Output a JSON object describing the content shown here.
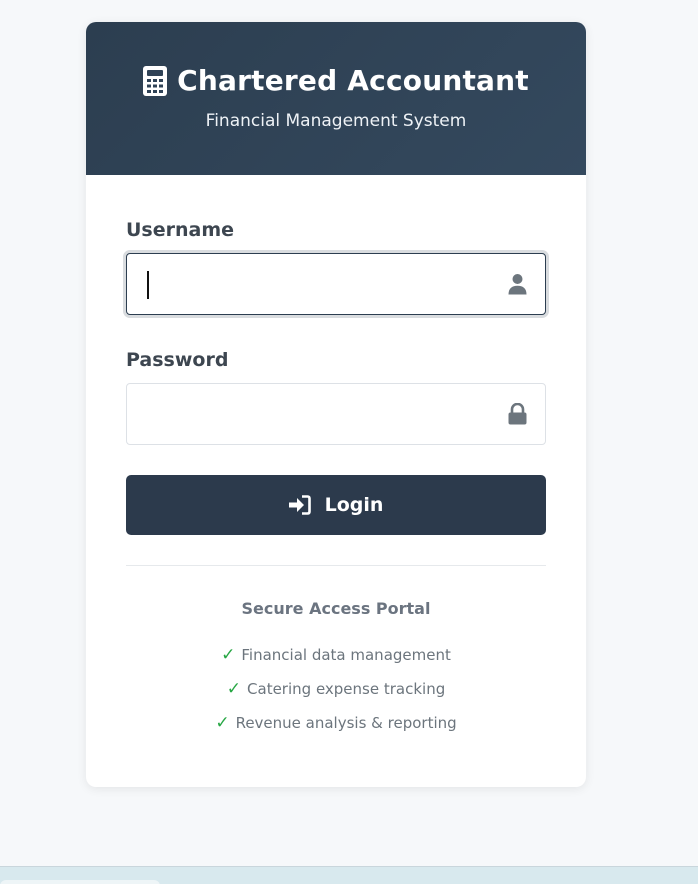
{
  "header": {
    "title": "Chartered Accountant",
    "subtitle": "Financial Management System",
    "icon": "calculator-icon"
  },
  "form": {
    "username": {
      "label": "Username",
      "value": "",
      "icon": "user-icon"
    },
    "password": {
      "label": "Password",
      "value": "",
      "icon": "lock-icon"
    },
    "login_button": {
      "label": "Login",
      "icon": "sign-in-icon"
    }
  },
  "footer": {
    "title": "Secure Access Portal",
    "check_symbol": "✓",
    "features": [
      "Financial data management",
      "Catering expense tracking",
      "Revenue analysis & reporting"
    ]
  },
  "colors": {
    "header_bg": "#2c3e50",
    "button_bg": "#2c3a4c",
    "check": "#28a745",
    "page_bg": "#f6f8fa"
  }
}
